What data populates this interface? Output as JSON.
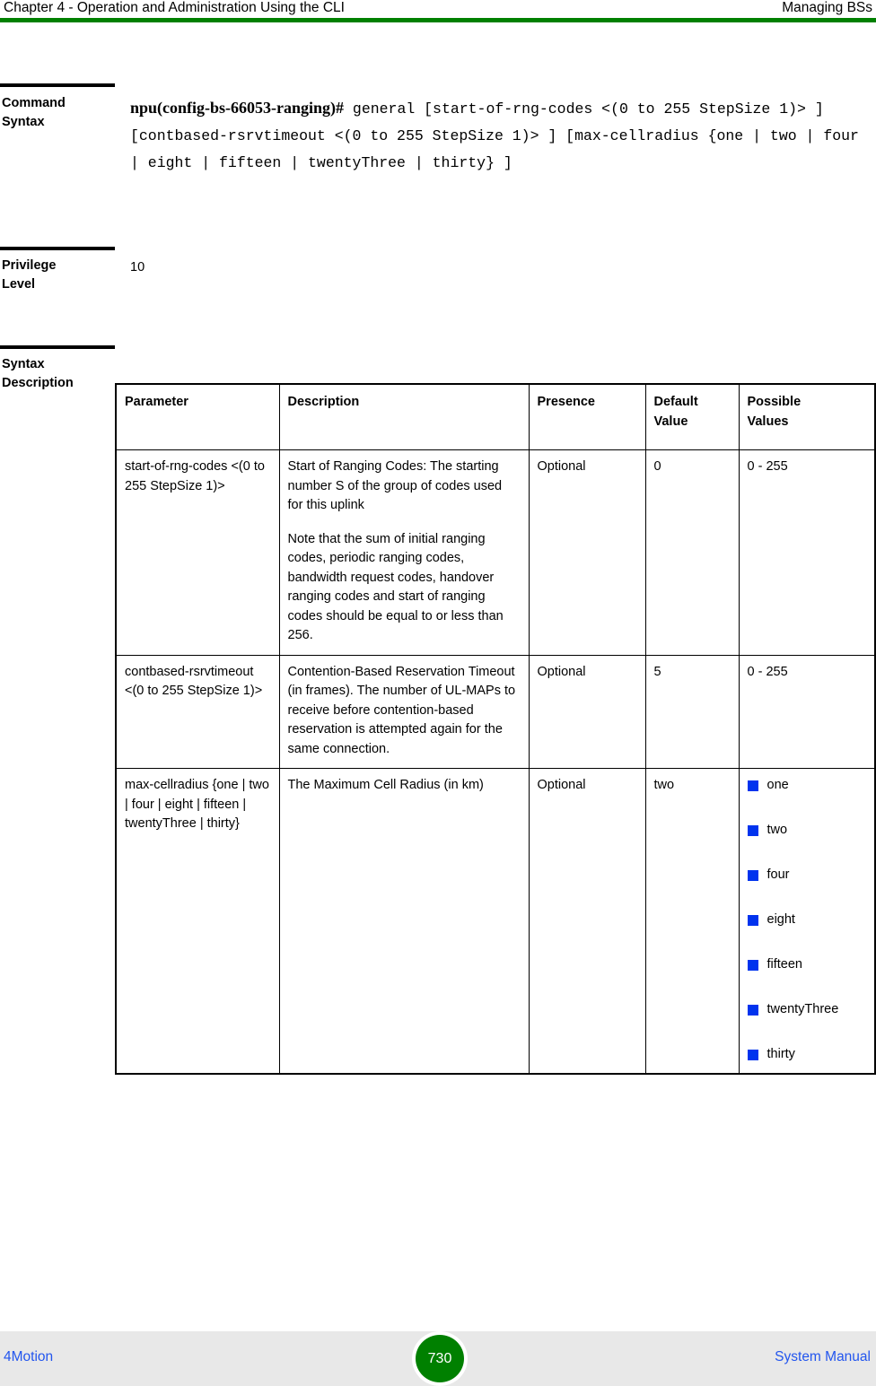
{
  "header": {
    "left": "Chapter 4 - Operation and Administration Using the CLI",
    "right": "Managing BSs",
    "rule_color": "#008000"
  },
  "sections": {
    "command_syntax": {
      "label_line1": "Command",
      "label_line2": "Syntax",
      "prompt": "npu(config-bs-66053-ranging)#",
      "command": " general [start-of-rng-codes <(0 to 255 StepSize 1)> ] [contbased-rsrvtimeout <(0 to 255 StepSize 1)> ] [max-cellradius {one | two | four | eight | fifteen | twentyThree | thirty} ]"
    },
    "privilege_level": {
      "label_line1": "Privilege",
      "label_line2": "Level",
      "value": "10"
    },
    "syntax_description": {
      "label_line1": "Syntax",
      "label_line2": "Description"
    }
  },
  "table": {
    "columns": [
      "Parameter",
      "Description",
      "Presence",
      "Default Value",
      "Possible Values"
    ],
    "header_default_line1": "Default",
    "header_default_line2": "Value",
    "header_possible_line1": "Possible",
    "header_possible_line2": "Values",
    "rows": [
      {
        "parameter": "start-of-rng-codes <(0 to 255 StepSize 1)>",
        "description_paragraphs": [
          "Start of Ranging Codes: The starting number S of the group of codes used for this uplink",
          "Note that the sum of initial ranging codes, periodic ranging codes, bandwidth request codes, handover ranging codes and start of ranging codes should be equal to or less than 256."
        ],
        "presence": "Optional",
        "default_value": "0",
        "possible_values_text": "0 - 255"
      },
      {
        "parameter": "contbased-rsrvtimeout <(0 to 255 StepSize 1)>",
        "description_paragraphs": [
          "Contention-Based Reservation Timeout (in frames). The number of UL-MAPs to receive before contention-based reservation is attempted again for the same connection."
        ],
        "presence": "Optional",
        "default_value": "5",
        "possible_values_text": "0 - 255"
      },
      {
        "parameter": "max-cellradius {one | two | four | eight | fifteen | twentyThree | thirty}",
        "description_paragraphs": [
          "The Maximum Cell Radius (in km)"
        ],
        "presence": "Optional",
        "default_value": "two",
        "possible_values_list": [
          "one",
          "two",
          "four",
          "eight",
          "fifteen",
          "twentyThree",
          "thirty"
        ],
        "bullet_color": "#0033ee"
      }
    ]
  },
  "footer": {
    "left": "4Motion",
    "page_number": "730",
    "right": "System Manual",
    "link_color": "#2255ee",
    "badge_color": "#008000"
  }
}
